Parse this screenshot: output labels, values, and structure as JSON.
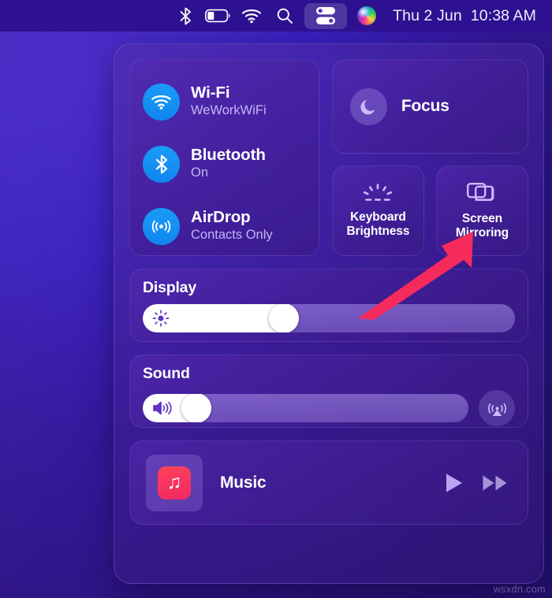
{
  "menubar": {
    "icons": [
      {
        "name": "bluetooth-icon",
        "label": "Bluetooth"
      },
      {
        "name": "battery-icon",
        "label": "Battery",
        "level_percent": 35
      },
      {
        "name": "wifi-icon",
        "label": "Wi-Fi"
      },
      {
        "name": "spotlight-search-icon",
        "label": "Spotlight Search"
      },
      {
        "name": "control-center-icon",
        "label": "Control Center"
      },
      {
        "name": "siri-icon",
        "label": "Siri"
      }
    ],
    "clock": "Thu 2 Jun  10:38 AM",
    "highlight_color": "#ffffff"
  },
  "control_center": {
    "connectivity": [
      {
        "icon": "wifi-icon",
        "title": "Wi-Fi",
        "status": "WeWorkWiFi"
      },
      {
        "icon": "bluetooth-icon",
        "title": "Bluetooth",
        "status": "On"
      },
      {
        "icon": "airdrop-icon",
        "title": "AirDrop",
        "status": "Contacts Only"
      }
    ],
    "connectivity_accent": "#1190f2",
    "focus": {
      "icon": "moon-icon",
      "label": "Focus"
    },
    "tiles": [
      {
        "icon": "keyboard-brightness-icon",
        "line1": "Keyboard",
        "line2": "Brightness"
      },
      {
        "icon": "screen-mirroring-icon",
        "line1": "Screen",
        "line2": "Mirroring"
      }
    ],
    "display": {
      "heading": "Display",
      "slider_icon": "brightness-sun-icon",
      "value_percent": 42
    },
    "sound": {
      "heading": "Sound",
      "slider_icon": "speaker-volume-icon",
      "value_percent": 21,
      "airplay_icon": "airplay-audio-icon"
    },
    "music": {
      "app_icon": "apple-music-icon",
      "app_icon_color": "#f5335f",
      "name": "Music",
      "controls": [
        {
          "icon": "play-icon",
          "label": "Play"
        },
        {
          "icon": "fast-forward-icon",
          "label": "Fast Forward"
        }
      ]
    }
  },
  "annotation": {
    "arrow_color": "#f72a5c",
    "points_to": "Screen Mirroring"
  },
  "watermark": "wsxdn.com"
}
